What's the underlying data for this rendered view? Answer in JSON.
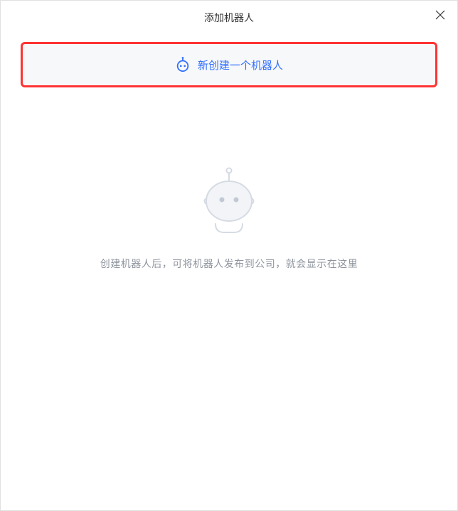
{
  "header": {
    "title": "添加机器人"
  },
  "createButton": {
    "label": "新创建一个机器人"
  },
  "emptyState": {
    "message": "创建机器人后，可将机器人发布到公司，就会显示在这里"
  }
}
